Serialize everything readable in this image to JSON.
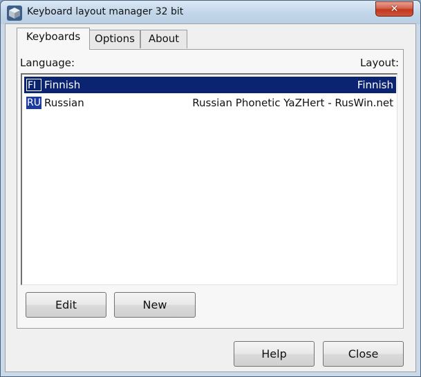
{
  "window": {
    "title": "Keyboard layout manager 32 bit",
    "close_glyph": "✕"
  },
  "tabs": [
    {
      "label": "Keyboards",
      "active": true
    },
    {
      "label": "Options",
      "active": false
    },
    {
      "label": "About",
      "active": false
    }
  ],
  "keyboards": {
    "language_header": "Language:",
    "layout_header": "Layout:",
    "rows": [
      {
        "icon": "FI",
        "language": "Finnish",
        "layout": "Finnish",
        "selected": true
      },
      {
        "icon": "RU",
        "language": "Russian",
        "layout": "Russian Phonetic YaZHert - RusWin.net",
        "selected": false
      }
    ],
    "edit_label": "Edit",
    "new_label": "New"
  },
  "footer": {
    "help_label": "Help",
    "close_label": "Close"
  },
  "colors": {
    "selection": "#0a2472",
    "close_button": "#c0391f"
  }
}
